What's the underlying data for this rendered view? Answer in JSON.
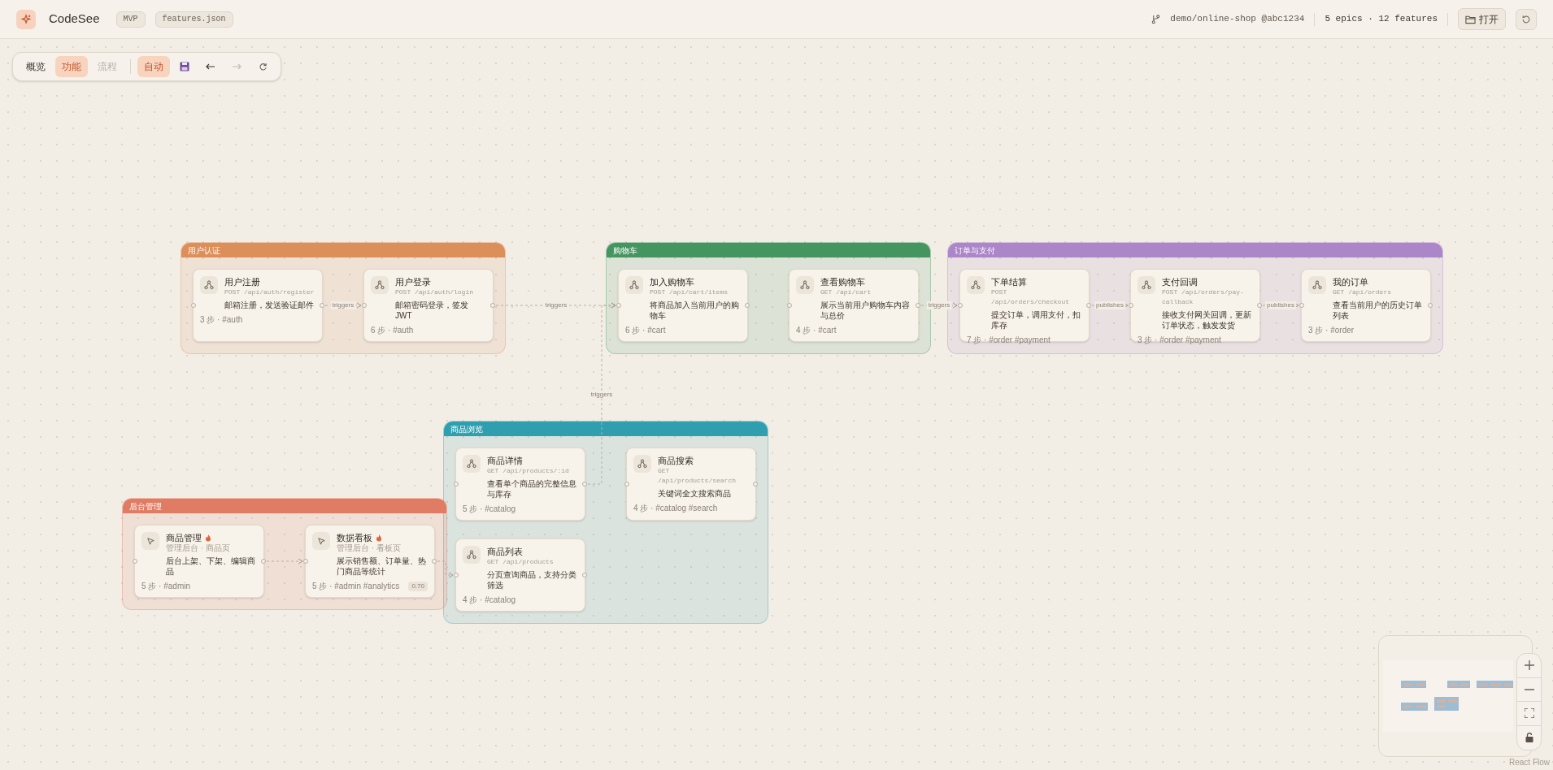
{
  "header": {
    "app_name": "CodeSee",
    "badges": [
      "MVP",
      "features.json"
    ],
    "repo": "demo/online-shop @abc1234",
    "stats": "5 epics · 12 features",
    "open_button": "打开"
  },
  "toolbar": {
    "tabs": [
      {
        "label": "概览",
        "selected": false,
        "disabled": false
      },
      {
        "label": "功能",
        "selected": true,
        "disabled": false
      },
      {
        "label": "流程",
        "selected": false,
        "disabled": true
      }
    ],
    "auto_layout": {
      "label": "自动",
      "on": true
    },
    "undo_enabled": true,
    "redo_enabled": false
  },
  "epics": [
    {
      "title": "用户认证",
      "color": "#dd8f5a",
      "features": [
        {
          "kind": "api",
          "title": "用户注册",
          "subtitle": "POST /api/auth/register",
          "description": "邮箱注册，发送验证邮件",
          "meta": "3 步 · #auth",
          "hot": false
        },
        {
          "kind": "api",
          "title": "用户登录",
          "subtitle": "POST /api/auth/login",
          "description": "邮箱密码登录，签发 JWT",
          "meta": "6 步 · #auth",
          "hot": false
        }
      ]
    },
    {
      "title": "购物车",
      "color": "#459560",
      "features": [
        {
          "kind": "api",
          "title": "加入购物车",
          "subtitle": "POST /api/cart/items",
          "description": "将商品加入当前用户的购物车",
          "meta": "6 步 · #cart",
          "hot": false
        },
        {
          "kind": "api",
          "title": "查看购物车",
          "subtitle": "GET /api/cart",
          "description": "展示当前用户购物车内容与总价",
          "meta": "4 步 · #cart",
          "hot": false
        }
      ]
    },
    {
      "title": "订单与支付",
      "color": "#ab86c8",
      "features": [
        {
          "kind": "api",
          "title": "下单结算",
          "subtitle": "POST /api/orders/checkout",
          "description": "提交订单，调用支付，扣库存",
          "meta": "7 步 · #order #payment",
          "hot": false
        },
        {
          "kind": "api",
          "title": "支付回调",
          "subtitle": "POST /api/orders/pay-callback",
          "description": "接收支付网关回调，更新订单状态，触发发货",
          "meta": "3 步 · #order #payment",
          "hot": false
        },
        {
          "kind": "api",
          "title": "我的订单",
          "subtitle": "GET /api/orders",
          "description": "查看当前用户的历史订单列表",
          "meta": "3 步 · #order",
          "hot": false
        }
      ]
    },
    {
      "title": "商品浏览",
      "color": "#2f9fb0",
      "features": [
        {
          "kind": "api",
          "title": "商品详情",
          "subtitle": "GET /api/products/:id",
          "description": "查看单个商品的完整信息与库存",
          "meta": "5 步 · #catalog",
          "hot": false
        },
        {
          "kind": "api",
          "title": "商品搜索",
          "subtitle": "GET /api/products/search",
          "description": "关键词全文搜索商品",
          "meta": "4 步 · #catalog #search",
          "hot": false
        },
        {
          "kind": "api",
          "title": "商品列表",
          "subtitle": "GET /api/products",
          "description": "分页查询商品，支持分类筛选",
          "meta": "4 步 · #catalog",
          "hot": false
        }
      ]
    },
    {
      "title": "后台管理",
      "color": "#e07c63",
      "features": [
        {
          "kind": "page",
          "title": "商品管理",
          "subtitle": "管理后台 · 商品页",
          "description": "后台上架、下架、编辑商品",
          "meta": "5 步 · #admin",
          "hot": true
        },
        {
          "kind": "page",
          "title": "数据看板",
          "subtitle": "管理后台 · 看板页",
          "description": "展示销售额、订单量、热门商品等统计",
          "meta": "5 步 · #admin #analytics",
          "hot": true,
          "badge": "0.70"
        }
      ]
    }
  ],
  "edges": [
    {
      "kind": "labeled",
      "label": "triggers"
    },
    {
      "kind": "labeled",
      "label": "triggers"
    },
    {
      "kind": "labeled",
      "label": "triggers"
    },
    {
      "kind": "labeled",
      "label": "publishes"
    },
    {
      "kind": "labeled",
      "label": "publishes"
    },
    {
      "kind": "labeled",
      "label": "triggers"
    },
    {
      "kind": "plain"
    },
    {
      "kind": "plain"
    }
  ],
  "attribution": "React Flow"
}
